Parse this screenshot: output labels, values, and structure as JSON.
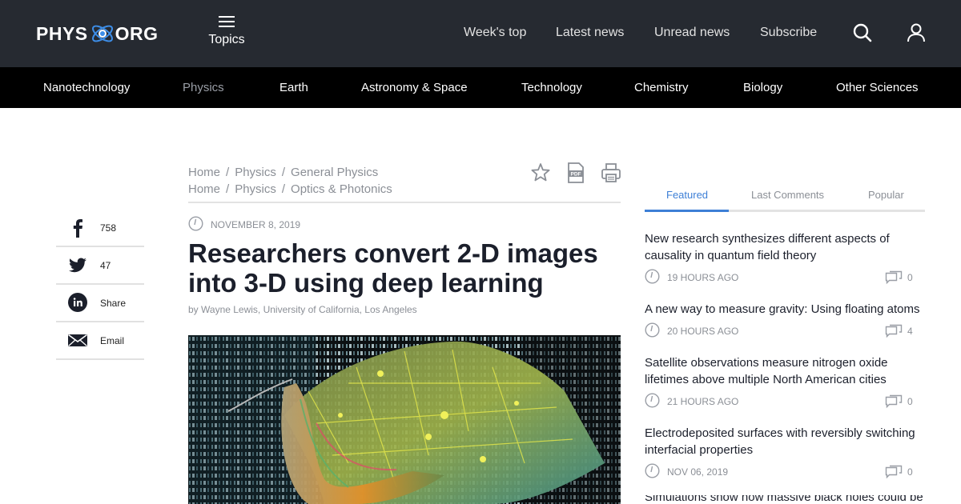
{
  "header": {
    "logo_left": "PHYS",
    "logo_right": "ORG",
    "topics_label": "Topics",
    "links": [
      "Week's top",
      "Latest news",
      "Unread news",
      "Subscribe"
    ],
    "icons": [
      "search-icon",
      "user-icon"
    ]
  },
  "categories": {
    "items": [
      "Nanotechnology",
      "Physics",
      "Earth",
      "Astronomy & Space",
      "Technology",
      "Chemistry",
      "Biology",
      "Other Sciences"
    ],
    "active": "Physics"
  },
  "share": [
    {
      "icon": "facebook-icon",
      "label": "758"
    },
    {
      "icon": "twitter-icon",
      "label": "47"
    },
    {
      "icon": "linkedin-icon",
      "label": "Share"
    },
    {
      "icon": "email-icon",
      "label": "Email"
    }
  ],
  "breadcrumbs": [
    [
      "Home",
      "Physics",
      "General Physics"
    ],
    [
      "Home",
      "Physics",
      "Optics & Photonics"
    ]
  ],
  "breadcrumb_separator": "/",
  "article": {
    "date": "NOVEMBER 8, 2019",
    "headline": "Researchers convert 2-D images into 3-D using deep learning",
    "byline": "by Wayne Lewis, University of California, Los Angeles",
    "tools": [
      "star-icon",
      "pdf-icon",
      "print-icon"
    ]
  },
  "sidebar": {
    "tabs": [
      "Featured",
      "Last Comments",
      "Popular"
    ],
    "active_tab": "Featured",
    "items": [
      {
        "title": "New research synthesizes different aspects of causality in quantum field theory",
        "time": "19 HOURS AGO",
        "comments": "0"
      },
      {
        "title": "A new way to measure gravity: Using floating atoms",
        "time": "20 HOURS AGO",
        "comments": "4"
      },
      {
        "title": "Satellite observations measure nitrogen oxide lifetimes above multiple North American cities",
        "time": "21 HOURS AGO",
        "comments": "0"
      },
      {
        "title": "Electrodeposited surfaces with reversibly switching interfacial properties",
        "time": "NOV 06, 2019",
        "comments": "0"
      },
      {
        "title": "Simulations show how massive black holes could be",
        "time": "",
        "comments": ""
      }
    ]
  },
  "colors": {
    "header_bg": "#262a31",
    "category_bg": "#000000",
    "accent": "#3d7fd6",
    "muted_text": "#8b8f96"
  }
}
